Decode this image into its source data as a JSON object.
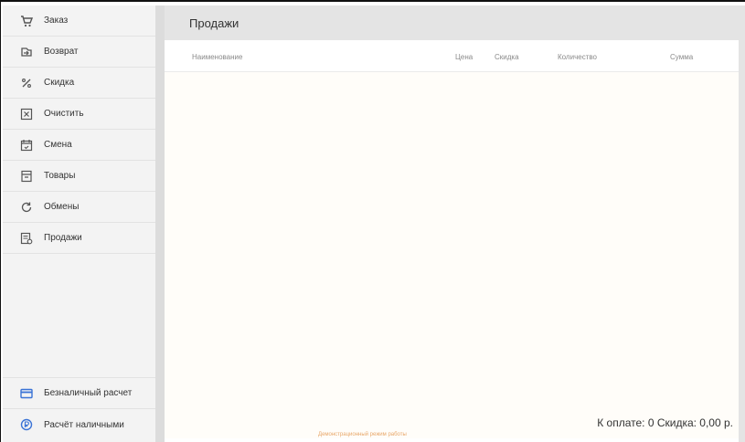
{
  "sidebar": {
    "items": [
      {
        "label": "Заказ",
        "icon": "cart-icon"
      },
      {
        "label": "Возврат",
        "icon": "return-icon"
      },
      {
        "label": "Скидка",
        "icon": "percent-icon"
      },
      {
        "label": "Очистить",
        "icon": "clear-icon"
      },
      {
        "label": "Смена",
        "icon": "calendar-icon"
      },
      {
        "label": "Товары",
        "icon": "goods-icon"
      },
      {
        "label": "Обмены",
        "icon": "refresh-icon"
      },
      {
        "label": "Продажи",
        "icon": "sales-icon"
      }
    ],
    "bottom_items": [
      {
        "label": "Безналичный расчет",
        "icon": "card-icon"
      },
      {
        "label": "Расчёт наличными",
        "icon": "cash-icon"
      }
    ]
  },
  "main": {
    "title": "Продажи",
    "columns": {
      "name": "Наименование",
      "price": "Цена",
      "discount": "Скидка",
      "quantity": "Количество",
      "sum": "Сумма"
    },
    "rows": [],
    "total_text": "К оплате: 0  Скидка: 0,00 р.",
    "demo_note": "Демонстрационный режим работы"
  },
  "colors": {
    "accent": "#3a73d6",
    "sidebar_bg": "#f3f3f3",
    "header_bg": "#e4e4e4",
    "demo_note": "#e8a76a"
  }
}
